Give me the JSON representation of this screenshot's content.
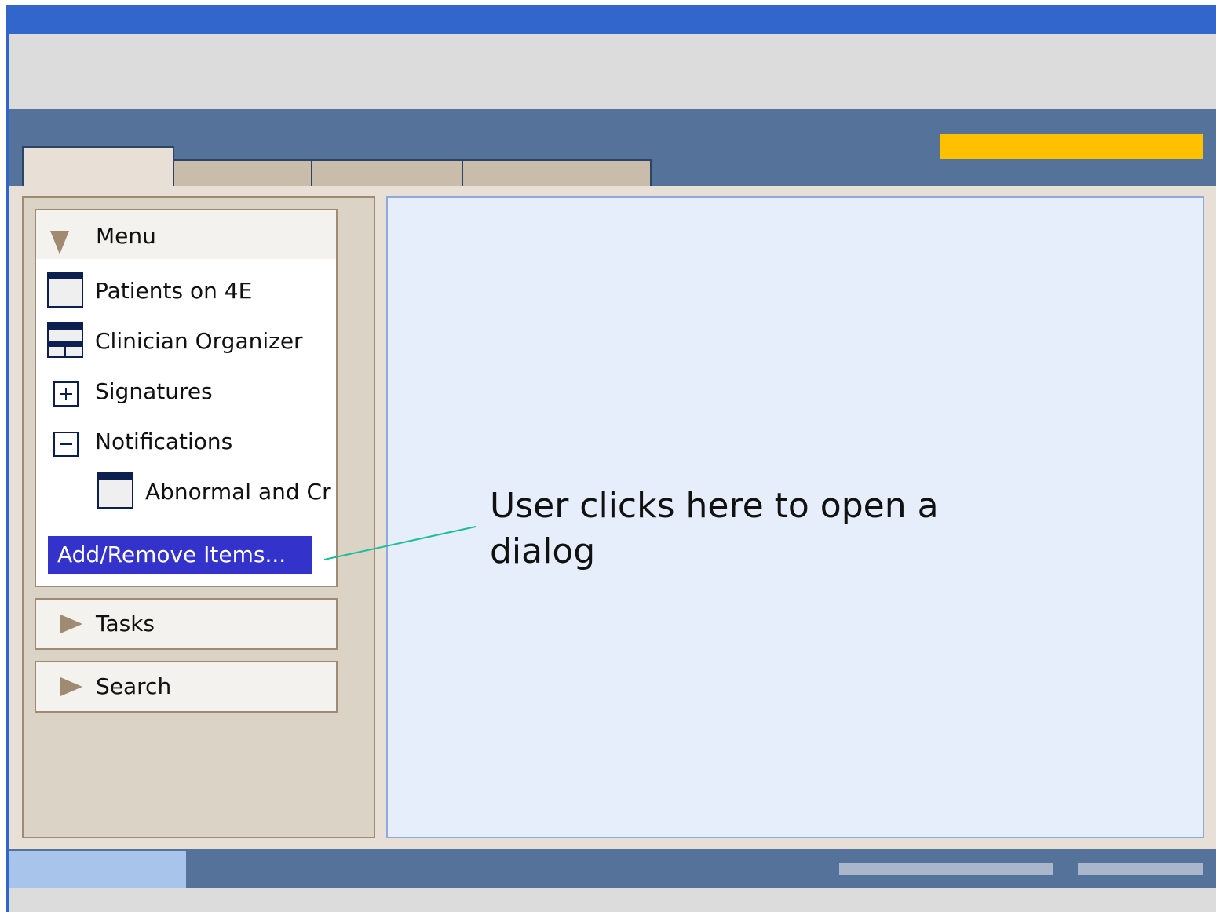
{
  "sidebar": {
    "menu_header": "Menu",
    "items": [
      {
        "label": "Patients on 4E",
        "icon": "window-icon"
      },
      {
        "label": "Clinician Organizer",
        "icon": "split-window-icon"
      },
      {
        "label": "Signatures",
        "icon": "expand-plus-icon"
      },
      {
        "label": "Notifications",
        "icon": "collapse-minus-icon"
      },
      {
        "label": "Abnormal and Cr",
        "icon": "window-icon"
      }
    ],
    "add_remove_label": "Add/Remove Items...",
    "tasks_header": "Tasks",
    "search_header": "Search"
  },
  "annotation": {
    "text": "User clicks here to open a dialog",
    "line_color": "#1abc9c"
  },
  "colors": {
    "titlebar": "#3366cc",
    "highlight": "#ffc000",
    "selected_button": "#3333cc",
    "main_pane": "#e5eefa"
  }
}
